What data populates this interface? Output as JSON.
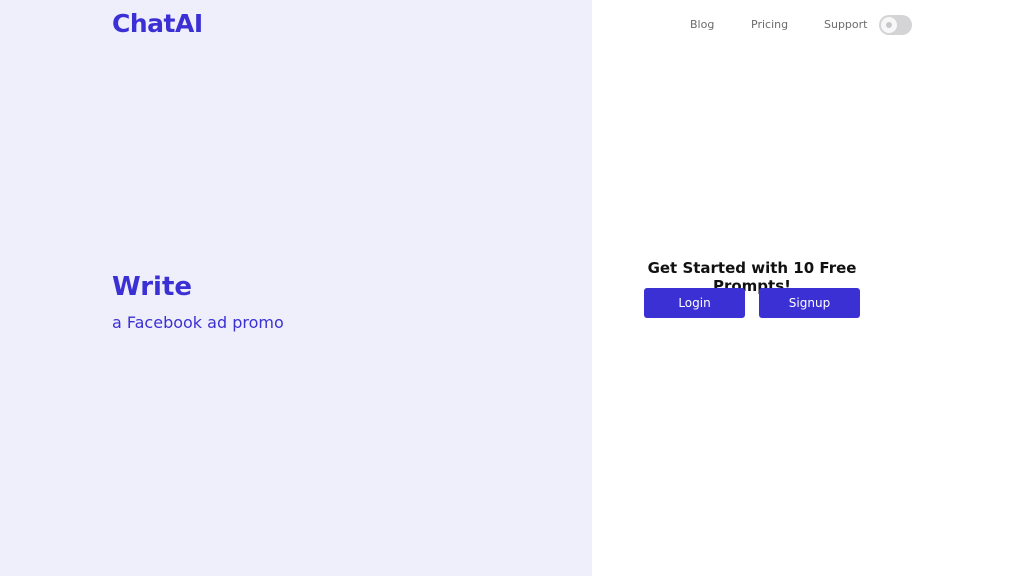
{
  "brand": {
    "name": "ChatAI",
    "color": "#3b30d4"
  },
  "nav": {
    "items": [
      {
        "label": "Blog"
      },
      {
        "label": "Pricing"
      },
      {
        "label": "Support"
      }
    ],
    "theme_toggle": {
      "icon": "toggle-switch-icon",
      "state": "off"
    }
  },
  "hero": {
    "title": "Write",
    "subtitle": "a Facebook ad promo"
  },
  "cta": {
    "heading": "Get Started with 10 Free Prompts!",
    "login_label": "Login",
    "signup_label": "Signup"
  },
  "colors": {
    "left_panel_bg": "#efeffc",
    "right_panel_bg": "#ffffff",
    "button_bg": "#3b30d4"
  }
}
